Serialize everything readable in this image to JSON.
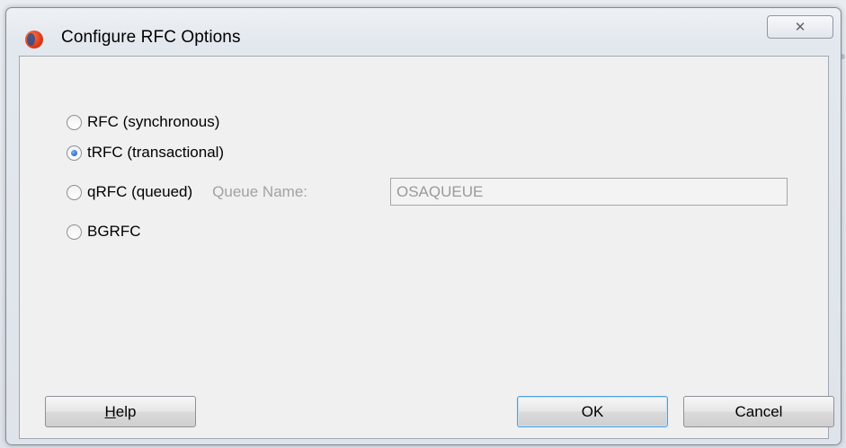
{
  "window": {
    "title": "Configure RFC Options",
    "close_glyph": "✕",
    "icon": "app-logo-icon"
  },
  "options": [
    {
      "label": "RFC (synchronous)",
      "checked": false
    },
    {
      "label": "tRFC (transactional)",
      "checked": true
    },
    {
      "label": "qRFC (queued)",
      "checked": false
    },
    {
      "label": "BGRFC",
      "checked": false
    }
  ],
  "queue": {
    "label": "Queue Name:",
    "value": "OSAQUEUE",
    "enabled": false
  },
  "buttons": {
    "help_first": "H",
    "help_rest": "elp",
    "ok": "OK",
    "cancel": "Cancel"
  }
}
